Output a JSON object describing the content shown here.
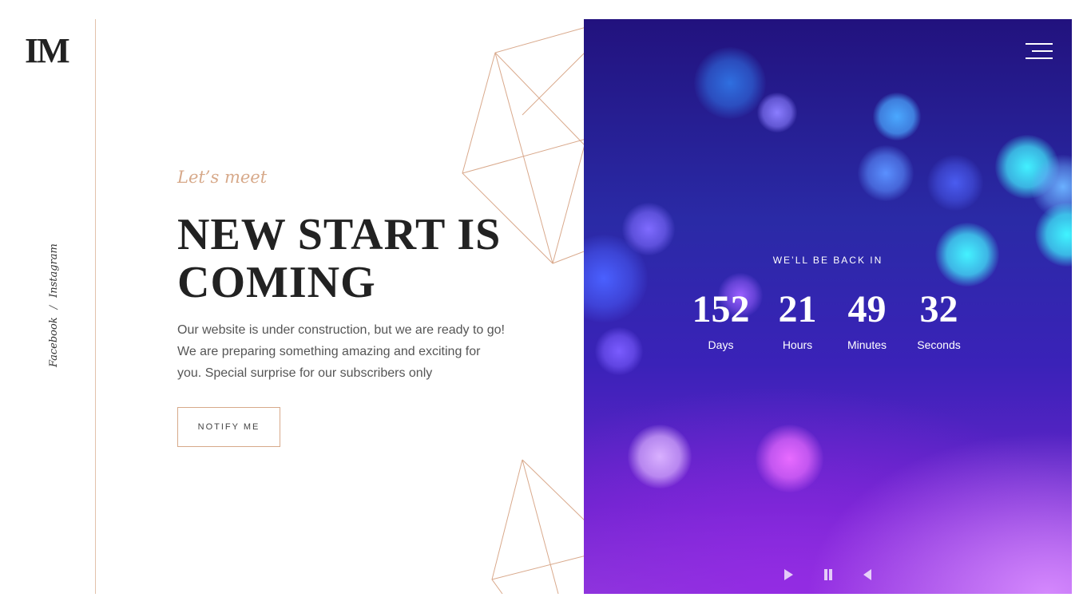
{
  "brand": {
    "logo_text": "IM"
  },
  "social": {
    "facebook_label": "Facebook",
    "separator": "/",
    "instagram_label": "Instagram"
  },
  "hero": {
    "eyebrow": "Let’s meet",
    "headline": "NEW START IS COMING",
    "description": "Our website is under construction, but we are ready to go! We are preparing something amazing and exciting for you. Special surprise for our subscribers only",
    "notify_button": "NOTIFY ME"
  },
  "countdown": {
    "heading": "WE’LL BE BACK IN",
    "days": {
      "value": "152",
      "label": "Days"
    },
    "hours": {
      "value": "21",
      "label": "Hours"
    },
    "minutes": {
      "value": "49",
      "label": "Minutes"
    },
    "seconds": {
      "value": "32",
      "label": "Seconds"
    }
  },
  "media_controls": {
    "play_icon": "play-icon",
    "pause_icon": "pause-icon",
    "volume_icon": "volume-icon"
  },
  "colors": {
    "accent": "#d7a98a",
    "text_dark": "#222222",
    "panel_top": "#22127e",
    "panel_bottom": "#8a3ad8"
  }
}
